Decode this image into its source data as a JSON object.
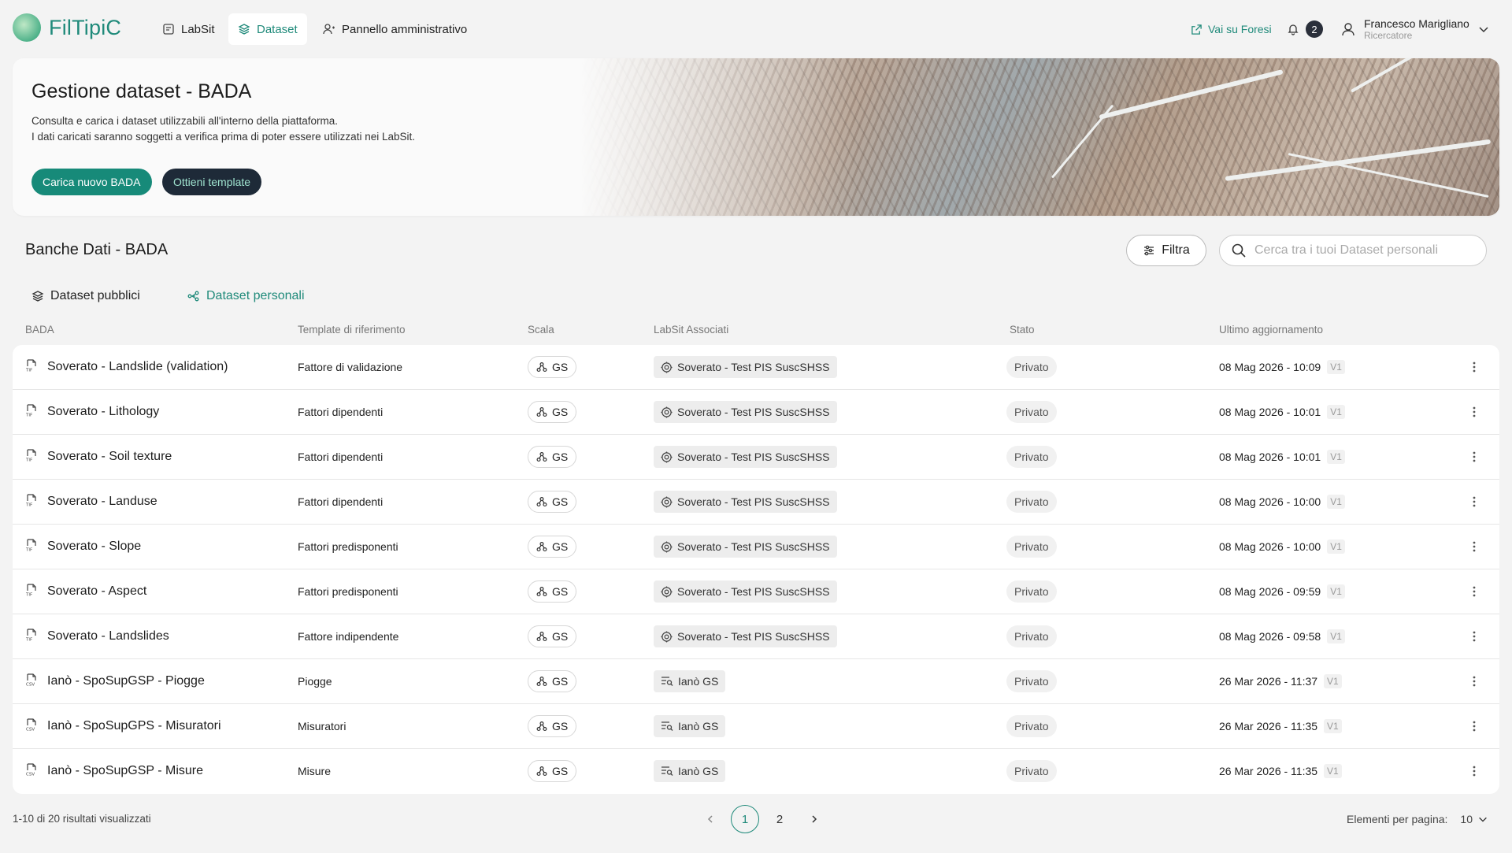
{
  "app": {
    "name": "FilTipiC"
  },
  "nav": {
    "labsit": "LabSit",
    "dataset": "Dataset",
    "admin": "Pannello amministrativo",
    "foresi": "Vai su Foresi",
    "notifications": "2",
    "user_name": "Francesco Marigliano",
    "user_role": "Ricercatore"
  },
  "hero": {
    "title": "Gestione dataset - BADA",
    "desc_line1": "Consulta e carica i dataset utilizzabili all'interno della piattaforma.",
    "desc_line2": "I dati caricati saranno soggetti a verifica prima di poter essere utilizzati nei LabSit.",
    "btn_upload": "Carica nuovo BADA",
    "btn_template": "Ottieni template"
  },
  "section": {
    "title": "Banche Dati - BADA",
    "filter": "Filtra",
    "search_placeholder": "Cerca tra i tuoi Dataset personali",
    "tab_public": "Dataset pubblici",
    "tab_personal": "Dataset personali"
  },
  "columns": {
    "bada": "BADA",
    "template": "Template di riferimento",
    "scala": "Scala",
    "labsit": "LabSit Associati",
    "stato": "Stato",
    "updated": "Ultimo aggiornamento"
  },
  "rows": [
    {
      "name": "Soverato - Landslide (validation)",
      "template": "Fattore di validazione",
      "scale": "GS",
      "labsit": "Soverato - Test PIS SuscSHSS",
      "stato": "Privato",
      "date": "08 Mag 2026 - 10:09",
      "version": "V1",
      "filetype": "tif-icon"
    },
    {
      "name": "Soverato - Lithology",
      "template": "Fattori dipendenti",
      "scale": "GS",
      "labsit": "Soverato - Test PIS SuscSHSS",
      "stato": "Privato",
      "date": "08 Mag 2026 - 10:01",
      "version": "V1",
      "filetype": "tif-icon"
    },
    {
      "name": "Soverato - Soil texture",
      "template": "Fattori dipendenti",
      "scale": "GS",
      "labsit": "Soverato - Test PIS SuscSHSS",
      "stato": "Privato",
      "date": "08 Mag 2026 - 10:01",
      "version": "V1",
      "filetype": "tif-icon"
    },
    {
      "name": "Soverato - Landuse",
      "template": "Fattori dipendenti",
      "scale": "GS",
      "labsit": "Soverato - Test PIS SuscSHSS",
      "stato": "Privato",
      "date": "08 Mag 2026 - 10:00",
      "version": "V1",
      "filetype": "tif-icon"
    },
    {
      "name": "Soverato - Slope",
      "template": "Fattori predisponenti",
      "scale": "GS",
      "labsit": "Soverato - Test PIS SuscSHSS",
      "stato": "Privato",
      "date": "08 Mag 2026 - 10:00",
      "version": "V1",
      "filetype": "tif-icon"
    },
    {
      "name": "Soverato - Aspect",
      "template": "Fattori predisponenti",
      "scale": "GS",
      "labsit": "Soverato - Test PIS SuscSHSS",
      "stato": "Privato",
      "date": "08 Mag 2026 - 09:59",
      "version": "V1",
      "filetype": "tif-icon"
    },
    {
      "name": "Soverato - Landslides",
      "template": "Fattore indipendente",
      "scale": "GS",
      "labsit": "Soverato - Test PIS SuscSHSS",
      "stato": "Privato",
      "date": "08 Mag 2026 - 09:58",
      "version": "V1",
      "filetype": "tif-icon"
    },
    {
      "name": "Ianò - SpoSupGSP - Piogge",
      "template": "Piogge",
      "scale": "GS",
      "labsit": "Ianò GS",
      "stato": "Privato",
      "date": "26 Mar 2026 - 11:37",
      "version": "V1",
      "filetype": "csv-icon"
    },
    {
      "name": "Ianò - SpoSupGPS - Misuratori",
      "template": "Misuratori",
      "scale": "GS",
      "labsit": "Ianò GS",
      "stato": "Privato",
      "date": "26 Mar 2026 - 11:35",
      "version": "V1",
      "filetype": "csv-icon"
    },
    {
      "name": "Ianò - SpoSupGSP - Misure",
      "template": "Misure",
      "scale": "GS",
      "labsit": "Ianò GS",
      "stato": "Privato",
      "date": "26 Mar 2026 - 11:35",
      "version": "V1",
      "filetype": "csv-icon"
    }
  ],
  "footer": {
    "results": "1-10 di 20 risultati visualizzati",
    "page1": "1",
    "page2": "2",
    "per_page_label": "Elementi per pagina:",
    "per_page_value": "10"
  }
}
